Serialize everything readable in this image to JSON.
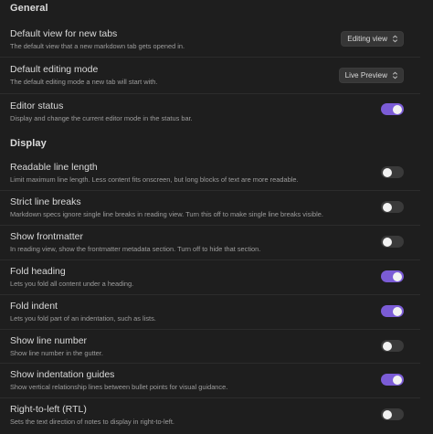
{
  "general": {
    "heading": "General",
    "default_view": {
      "name": "Default view for new tabs",
      "description": "The default view that a new markdown tab gets opened in.",
      "value": "Editing view"
    },
    "default_editing_mode": {
      "name": "Default editing mode",
      "description": "The default editing mode a new tab will start with.",
      "value": "Live Preview"
    },
    "editor_status": {
      "name": "Editor status",
      "description": "Display and change the current editor mode in the status bar.",
      "enabled": true
    }
  },
  "display": {
    "heading": "Display",
    "items": [
      {
        "name": "Readable line length",
        "description": "Limit maximum line length. Less content fits onscreen, but long blocks of text are more readable.",
        "enabled": false
      },
      {
        "name": "Strict line breaks",
        "description": "Markdown specs ignore single line breaks in reading view. Turn this off to make single line breaks visible.",
        "enabled": false
      },
      {
        "name": "Show frontmatter",
        "description": "In reading view, show the frontmatter metadata section. Turn off to hide that section.",
        "enabled": false
      },
      {
        "name": "Fold heading",
        "description": "Lets you fold all content under a heading.",
        "enabled": true
      },
      {
        "name": "Fold indent",
        "description": "Lets you fold part of an indentation, such as lists.",
        "enabled": true
      },
      {
        "name": "Show line number",
        "description": "Show line number in the gutter.",
        "enabled": false
      },
      {
        "name": "Show indentation guides",
        "description": "Show vertical relationship lines between bullet points for visual guidance.",
        "enabled": true
      },
      {
        "name": "Right-to-left (RTL)",
        "description": "Sets the text direction of notes to display in right-to-left.",
        "enabled": false
      }
    ]
  },
  "colors": {
    "toggle_on": "#7b5cd6",
    "toggle_off": "#3a3a3a",
    "background": "#1e1e1e"
  },
  "icons": {
    "dropdown": "chevron-up-down-icon"
  }
}
